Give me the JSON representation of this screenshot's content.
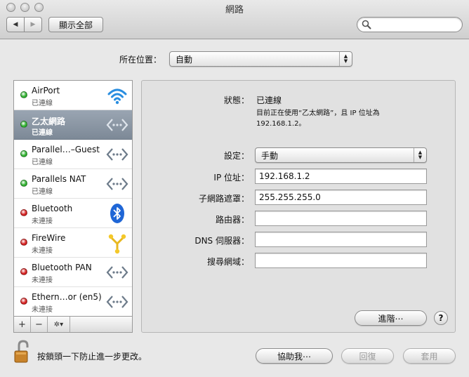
{
  "window": {
    "title": "網路"
  },
  "toolbar": {
    "back_glyph": "◀",
    "forward_glyph": "▶",
    "show_all_label": "顯示全部",
    "search_placeholder": ""
  },
  "location": {
    "label": "所在位置：",
    "value": "自動"
  },
  "services": [
    {
      "name": "AirPort",
      "status": "已連線",
      "status_color": "#2fb12f",
      "icon": "wifi-icon"
    },
    {
      "name": "乙太網路",
      "status": "已連線",
      "status_color": "#2fb12f",
      "icon": "ethernet-icon"
    },
    {
      "name": "Parallel…–Guest",
      "status": "已連線",
      "status_color": "#2fb12f",
      "icon": "ethernet-icon"
    },
    {
      "name": "Parallels NAT",
      "status": "已連線",
      "status_color": "#2fb12f",
      "icon": "ethernet-icon"
    },
    {
      "name": "Bluetooth",
      "status": "未連接",
      "status_color": "#d42020",
      "icon": "bluetooth-icon"
    },
    {
      "name": "FireWire",
      "status": "未連接",
      "status_color": "#d42020",
      "icon": "firewire-icon"
    },
    {
      "name": "Bluetooth PAN",
      "status": "未連接",
      "status_color": "#d42020",
      "icon": "ethernet-icon"
    },
    {
      "name": "Ethern…or (en5)",
      "status": "未連接",
      "status_color": "#d42020",
      "icon": "ethernet-icon"
    }
  ],
  "sidebar_controls": {
    "add": "+",
    "remove": "−",
    "action": "✲▾"
  },
  "detail": {
    "status_label": "狀態：",
    "status_value": "已連線",
    "status_desc_line1": "目前正在使用“乙太網路”，且 IP 位址為",
    "status_desc_line2": "192.168.1.2。",
    "config_label": "設定：",
    "config_value": "手動",
    "ip_label": "IP 位址：",
    "ip_value": "192.168.1.2",
    "subnet_label": "子網路遮罩：",
    "subnet_value": "255.255.255.0",
    "router_label": "路由器：",
    "router_value": "",
    "dns_label": "DNS 伺服器：",
    "dns_value": "",
    "search_domain_label": "搜尋網域：",
    "search_domain_value": "",
    "advanced_label": "進階⋯",
    "help_label": "?"
  },
  "footer": {
    "lock_text": "按鎖頭一下防止進一步更改。",
    "assist_label": "協助我⋯",
    "revert_label": "回復",
    "apply_label": "套用"
  },
  "colors": {
    "selected_row": "#8a95a3",
    "panel_bg": "#e1e1e1"
  }
}
